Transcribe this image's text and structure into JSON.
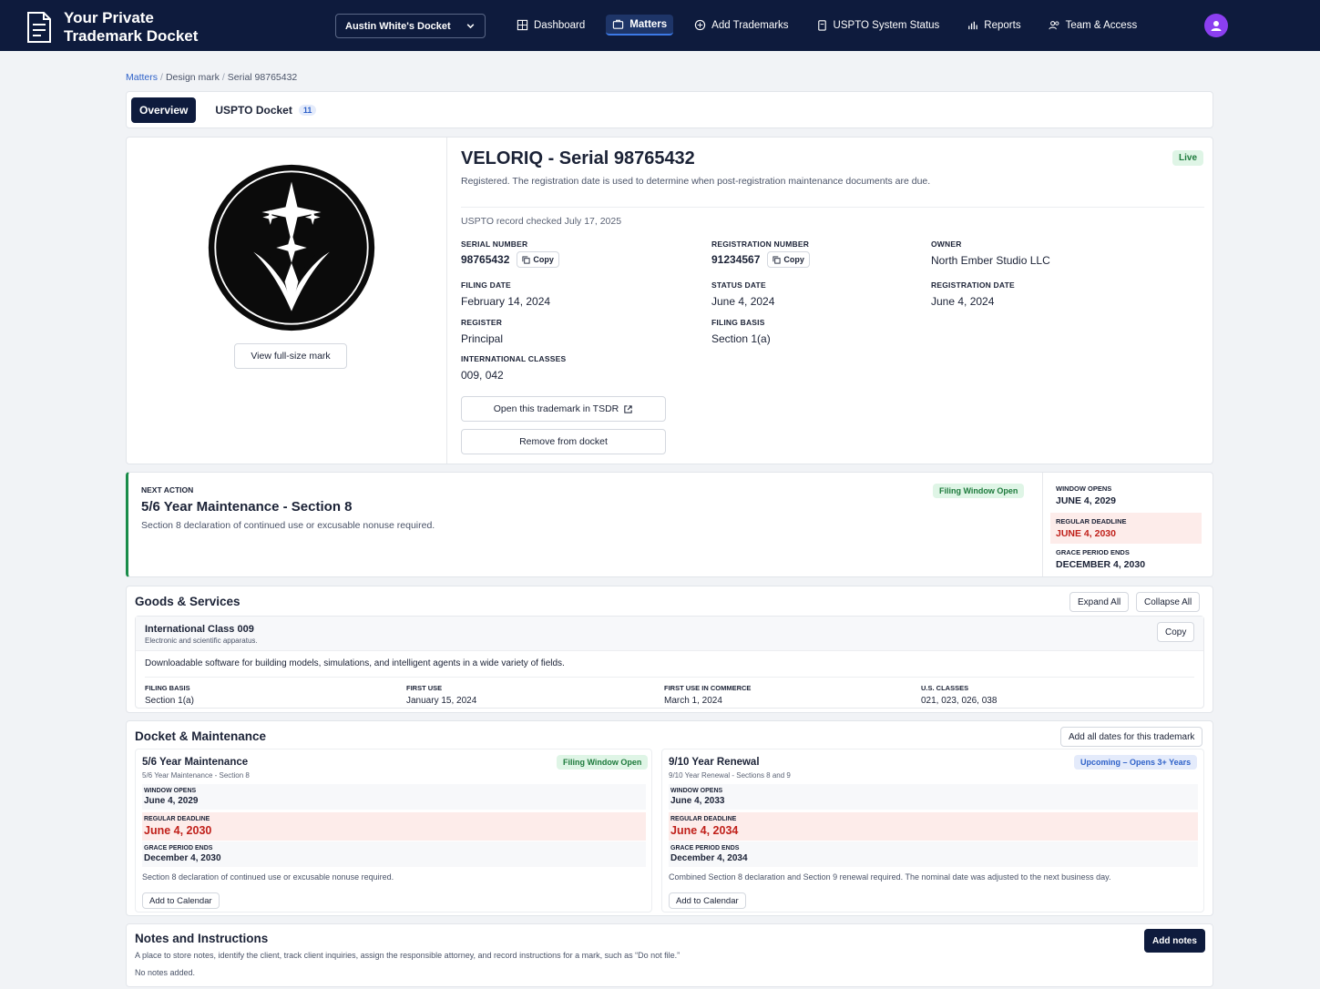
{
  "app": {
    "title": "Your Private Trademark Docket",
    "docket_select": "Austin White's Docket"
  },
  "nav": [
    {
      "label": "Dashboard",
      "icon": "grid-icon"
    },
    {
      "label": "Matters",
      "icon": "briefcase-icon",
      "active": true
    },
    {
      "label": "Add Trademarks",
      "icon": "plus-circle-icon"
    },
    {
      "label": "USPTO System Status",
      "icon": "clipboard-icon"
    },
    {
      "label": "Reports",
      "icon": "bar-chart-icon"
    },
    {
      "label": "Team & Access",
      "icon": "users-icon"
    }
  ],
  "breadcrumb": {
    "root": "Matters",
    "middle": "Design mark",
    "current": "Serial 98765432"
  },
  "tabs": {
    "overview": "Overview",
    "docket": "USPTO Docket",
    "docket_count": "11"
  },
  "mark": {
    "view_button": "View full-size mark",
    "title": "VELORIQ - Serial 98765432",
    "status_badge": "Live",
    "description": "Registered. The registration date is used to determine when post-registration maintenance documents are due.",
    "checked": "USPTO record checked July 17, 2025",
    "copy_label": "Copy",
    "fields": {
      "serial_label": "Serial Number",
      "serial": "98765432",
      "reg_label": "Registration Number",
      "reg": "91234567",
      "owner_label": "Owner",
      "owner": "North Ember Studio LLC",
      "filing_date_label": "Filing Date",
      "filing_date": "February 14, 2024",
      "status_date_label": "Status Date",
      "status_date": "June 4, 2024",
      "reg_date_label": "Registration Date",
      "reg_date": "June 4, 2024",
      "register_label": "Register",
      "register": "Principal",
      "filing_basis_label": "Filing Basis",
      "filing_basis": "Section 1(a)",
      "classes_label": "International Classes",
      "classes": "009, 042"
    },
    "open_tsdr": "Open this trademark in TSDR",
    "remove": "Remove from docket"
  },
  "next_action": {
    "label": "Next Action",
    "title": "5/6 Year Maintenance - Section 8",
    "desc": "Section 8 declaration of continued use or excusable nonuse required.",
    "badge": "Filing Window Open",
    "window_opens_label": "Window Opens",
    "window_opens": "June 4, 2029",
    "deadline_label": "Regular Deadline",
    "deadline": "June 4, 2030",
    "grace_label": "Grace Period Ends",
    "grace": "December 4, 2030"
  },
  "goods": {
    "title": "Goods & Services",
    "expand": "Expand All",
    "collapse": "Collapse All",
    "copy": "Copy",
    "class_title": "International Class 009",
    "class_sub": "Electronic and scientific apparatus.",
    "text": "Downloadable software for building models, simulations, and intelligent agents in a wide variety of fields.",
    "filing_basis_label": "Filing Basis",
    "filing_basis": "Section 1(a)",
    "first_use_label": "First Use",
    "first_use": "January 15, 2024",
    "commerce_label": "First Use in Commerce",
    "commerce": "March 1, 2024",
    "us_classes_label": "U.S. Classes",
    "us_classes": "021, 023, 026, 038"
  },
  "docket": {
    "title": "Docket & Maintenance",
    "add_all": "Add all dates for this trademark",
    "calendar": "Add to Calendar",
    "window_label": "Window Opens",
    "deadline_label": "Regular Deadline",
    "grace_label": "Grace Period Ends",
    "left": {
      "title": "5/6 Year Maintenance",
      "sub": "5/6 Year Maintenance - Section 8",
      "badge": "Filing Window Open",
      "window": "June 4, 2029",
      "deadline": "June 4, 2030",
      "grace": "December 4, 2030",
      "note": "Section 8 declaration of continued use or excusable nonuse required."
    },
    "right": {
      "title": "9/10 Year Renewal",
      "sub": "9/10 Year Renewal - Sections 8 and 9",
      "badge": "Upcoming – Opens 3+ Years",
      "window": "June 4, 2033",
      "deadline": "June 4, 2034",
      "grace": "December 4, 2034",
      "note": "Combined Section 8 declaration and Section 9 renewal required. The nominal date was adjusted to the next business day."
    }
  },
  "notes": {
    "title": "Notes and Instructions",
    "desc": "A place to store notes, identify the client, track client inquiries, assign the responsible attorney, and record instructions for a mark, such as “Do not file.”",
    "empty": "No notes added.",
    "add": "Add notes"
  }
}
